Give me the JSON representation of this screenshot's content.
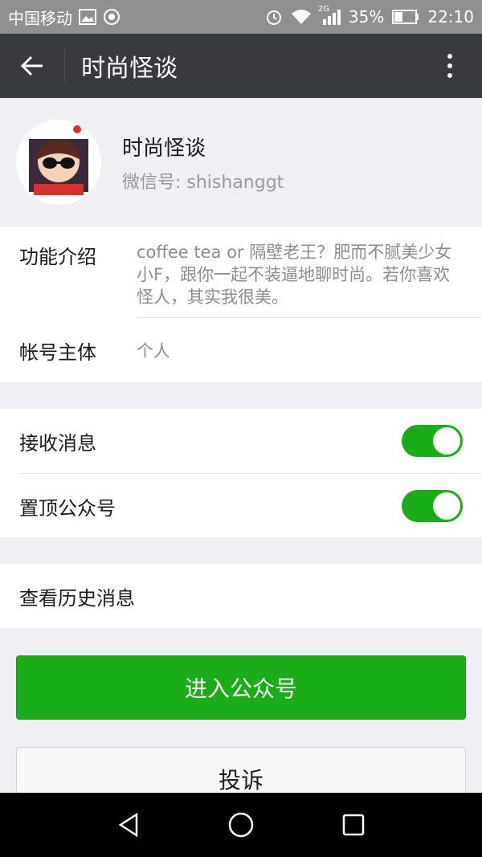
{
  "status_bar": {
    "carrier": "中国移动",
    "network": "2G",
    "battery": "35%",
    "time": "22:10",
    "icons": [
      "image-icon",
      "app-notification-icon",
      "alarm-icon",
      "wifi-icon",
      "signal-icon",
      "battery-icon"
    ]
  },
  "header": {
    "title": "时尚怪谈",
    "back_icon": "arrow-left-icon",
    "more_icon": "more-vertical-icon"
  },
  "profile": {
    "name": "时尚怪谈",
    "wechat_id": "微信号: shishanggt",
    "avatar_text": "时尚怪谈"
  },
  "info": {
    "intro_label": "功能介绍",
    "intro_value": "coffee tea or 隔壁老王？肥而不腻美少女小F，跟你一起不装逼地聊时尚。若你喜欢怪人，其实我很美。",
    "account_label": "帐号主体",
    "account_value": "个人"
  },
  "settings": {
    "receive_label": "接收消息",
    "receive_on": true,
    "pin_label": "置顶公众号",
    "pin_on": true
  },
  "history": {
    "label": "查看历史消息"
  },
  "actions": {
    "enter_label": "进入公众号",
    "report_label": "投诉"
  },
  "colors": {
    "accent": "#1aad19",
    "titlebar": "#393a3f",
    "statusbar": "#8f8f8f",
    "background": "#efeff4"
  },
  "nav": {
    "icons": [
      "back-triangle-icon",
      "home-circle-icon",
      "recents-square-icon"
    ]
  }
}
